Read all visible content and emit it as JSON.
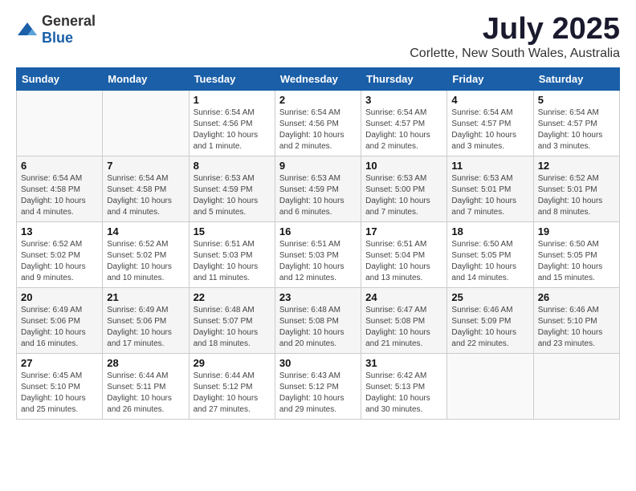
{
  "logo": {
    "general": "General",
    "blue": "Blue"
  },
  "title": "July 2025",
  "subtitle": "Corlette, New South Wales, Australia",
  "headers": [
    "Sunday",
    "Monday",
    "Tuesday",
    "Wednesday",
    "Thursday",
    "Friday",
    "Saturday"
  ],
  "weeks": [
    [
      {
        "day": "",
        "info": ""
      },
      {
        "day": "",
        "info": ""
      },
      {
        "day": "1",
        "info": "Sunrise: 6:54 AM\nSunset: 4:56 PM\nDaylight: 10 hours\nand 1 minute."
      },
      {
        "day": "2",
        "info": "Sunrise: 6:54 AM\nSunset: 4:56 PM\nDaylight: 10 hours\nand 2 minutes."
      },
      {
        "day": "3",
        "info": "Sunrise: 6:54 AM\nSunset: 4:57 PM\nDaylight: 10 hours\nand 2 minutes."
      },
      {
        "day": "4",
        "info": "Sunrise: 6:54 AM\nSunset: 4:57 PM\nDaylight: 10 hours\nand 3 minutes."
      },
      {
        "day": "5",
        "info": "Sunrise: 6:54 AM\nSunset: 4:57 PM\nDaylight: 10 hours\nand 3 minutes."
      }
    ],
    [
      {
        "day": "6",
        "info": "Sunrise: 6:54 AM\nSunset: 4:58 PM\nDaylight: 10 hours\nand 4 minutes."
      },
      {
        "day": "7",
        "info": "Sunrise: 6:54 AM\nSunset: 4:58 PM\nDaylight: 10 hours\nand 4 minutes."
      },
      {
        "day": "8",
        "info": "Sunrise: 6:53 AM\nSunset: 4:59 PM\nDaylight: 10 hours\nand 5 minutes."
      },
      {
        "day": "9",
        "info": "Sunrise: 6:53 AM\nSunset: 4:59 PM\nDaylight: 10 hours\nand 6 minutes."
      },
      {
        "day": "10",
        "info": "Sunrise: 6:53 AM\nSunset: 5:00 PM\nDaylight: 10 hours\nand 7 minutes."
      },
      {
        "day": "11",
        "info": "Sunrise: 6:53 AM\nSunset: 5:01 PM\nDaylight: 10 hours\nand 7 minutes."
      },
      {
        "day": "12",
        "info": "Sunrise: 6:52 AM\nSunset: 5:01 PM\nDaylight: 10 hours\nand 8 minutes."
      }
    ],
    [
      {
        "day": "13",
        "info": "Sunrise: 6:52 AM\nSunset: 5:02 PM\nDaylight: 10 hours\nand 9 minutes."
      },
      {
        "day": "14",
        "info": "Sunrise: 6:52 AM\nSunset: 5:02 PM\nDaylight: 10 hours\nand 10 minutes."
      },
      {
        "day": "15",
        "info": "Sunrise: 6:51 AM\nSunset: 5:03 PM\nDaylight: 10 hours\nand 11 minutes."
      },
      {
        "day": "16",
        "info": "Sunrise: 6:51 AM\nSunset: 5:03 PM\nDaylight: 10 hours\nand 12 minutes."
      },
      {
        "day": "17",
        "info": "Sunrise: 6:51 AM\nSunset: 5:04 PM\nDaylight: 10 hours\nand 13 minutes."
      },
      {
        "day": "18",
        "info": "Sunrise: 6:50 AM\nSunset: 5:05 PM\nDaylight: 10 hours\nand 14 minutes."
      },
      {
        "day": "19",
        "info": "Sunrise: 6:50 AM\nSunset: 5:05 PM\nDaylight: 10 hours\nand 15 minutes."
      }
    ],
    [
      {
        "day": "20",
        "info": "Sunrise: 6:49 AM\nSunset: 5:06 PM\nDaylight: 10 hours\nand 16 minutes."
      },
      {
        "day": "21",
        "info": "Sunrise: 6:49 AM\nSunset: 5:06 PM\nDaylight: 10 hours\nand 17 minutes."
      },
      {
        "day": "22",
        "info": "Sunrise: 6:48 AM\nSunset: 5:07 PM\nDaylight: 10 hours\nand 18 minutes."
      },
      {
        "day": "23",
        "info": "Sunrise: 6:48 AM\nSunset: 5:08 PM\nDaylight: 10 hours\nand 20 minutes."
      },
      {
        "day": "24",
        "info": "Sunrise: 6:47 AM\nSunset: 5:08 PM\nDaylight: 10 hours\nand 21 minutes."
      },
      {
        "day": "25",
        "info": "Sunrise: 6:46 AM\nSunset: 5:09 PM\nDaylight: 10 hours\nand 22 minutes."
      },
      {
        "day": "26",
        "info": "Sunrise: 6:46 AM\nSunset: 5:10 PM\nDaylight: 10 hours\nand 23 minutes."
      }
    ],
    [
      {
        "day": "27",
        "info": "Sunrise: 6:45 AM\nSunset: 5:10 PM\nDaylight: 10 hours\nand 25 minutes."
      },
      {
        "day": "28",
        "info": "Sunrise: 6:44 AM\nSunset: 5:11 PM\nDaylight: 10 hours\nand 26 minutes."
      },
      {
        "day": "29",
        "info": "Sunrise: 6:44 AM\nSunset: 5:12 PM\nDaylight: 10 hours\nand 27 minutes."
      },
      {
        "day": "30",
        "info": "Sunrise: 6:43 AM\nSunset: 5:12 PM\nDaylight: 10 hours\nand 29 minutes."
      },
      {
        "day": "31",
        "info": "Sunrise: 6:42 AM\nSunset: 5:13 PM\nDaylight: 10 hours\nand 30 minutes."
      },
      {
        "day": "",
        "info": ""
      },
      {
        "day": "",
        "info": ""
      }
    ]
  ]
}
